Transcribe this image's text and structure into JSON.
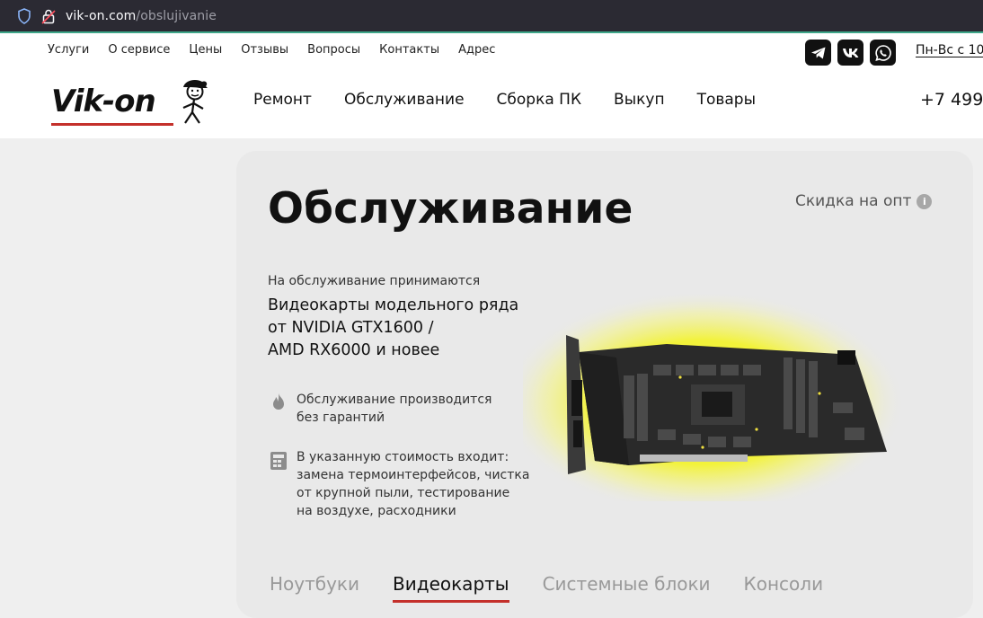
{
  "browser": {
    "url_host": "vik-on.com",
    "url_path": "/obslujivanie"
  },
  "header": {
    "top_links": [
      "Услуги",
      "О сервисе",
      "Цены",
      "Отзывы",
      "Вопросы",
      "Контакты",
      "Адрес"
    ],
    "social_icons": [
      "telegram-icon",
      "vk-icon",
      "whatsapp-icon"
    ],
    "hours": "Пн-Вс с 10",
    "logo": "Vik-on",
    "main_nav": [
      "Ремонт",
      "Обслуживание",
      "Сборка ПК",
      "Выкуп",
      "Товары"
    ],
    "phone": "+7 499"
  },
  "main": {
    "title": "Обслуживание",
    "discount_label": "Скидка на опт",
    "intro": "На обслуживание принимаются",
    "models_lines": [
      "Видеокарты модельного ряда",
      "от NVIDIA GTX1600 /",
      "AMD RX6000 и новее"
    ],
    "features": [
      {
        "icon": "flame-icon",
        "lines": [
          "Обслуживание производится",
          "без гарантий"
        ]
      },
      {
        "icon": "calculator-icon",
        "lines": [
          "В указанную стоимость входит:",
          "замена термоинтерфейсов, чистка",
          "от крупной пыли, тестирование",
          "на воздухе, расходники"
        ]
      }
    ],
    "tabs": [
      "Ноутбуки",
      "Видеокарты",
      "Системные блоки",
      "Консоли"
    ],
    "active_tab": 1
  },
  "colors": {
    "accent": "#c4302b",
    "glow": "#f2f23a"
  }
}
